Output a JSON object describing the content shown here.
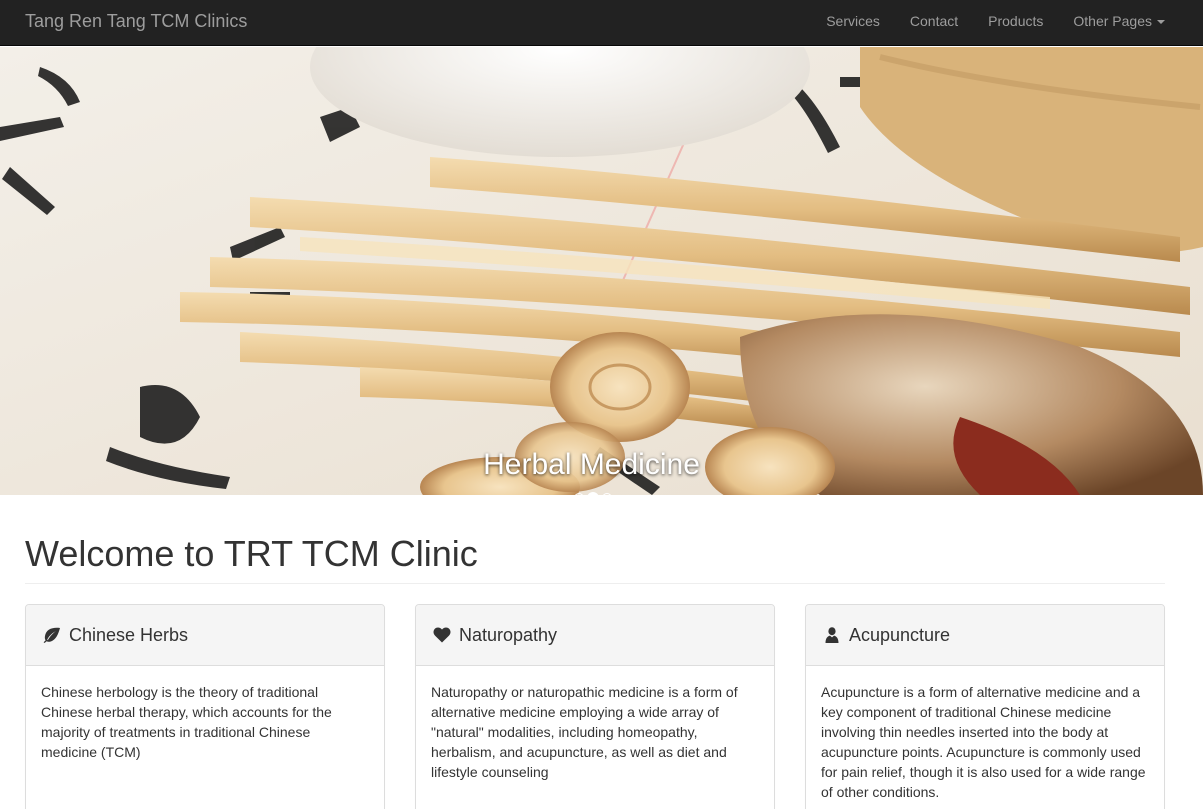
{
  "navbar": {
    "brand": "Tang Ren Tang TCM Clinics",
    "items": [
      {
        "label": "Services"
      },
      {
        "label": "Contact"
      },
      {
        "label": "Products"
      },
      {
        "label": "Other Pages",
        "dropdown": true
      }
    ]
  },
  "carousel": {
    "caption": "Herbal Medicine",
    "slide_count": 3,
    "active_index": 1
  },
  "welcome": {
    "title": "Welcome to TRT TCM Clinic"
  },
  "panels": [
    {
      "icon": "leaf-icon",
      "title": "Chinese Herbs",
      "body": "Chinese herbology is the theory of traditional Chinese herbal therapy, which accounts for the majority of treatments in traditional Chinese medicine (TCM)"
    },
    {
      "icon": "heart-icon",
      "title": "Naturopathy",
      "body": "Naturopathy or naturopathic medicine is a form of alternative medicine employing a wide array of \"natural\" modalities, including homeopathy, herbalism, and acupuncture, as well as diet and lifestyle counseling"
    },
    {
      "icon": "user-icon",
      "title": "Acupuncture",
      "body": "Acupuncture is a form of alternative medicine and a key component of traditional Chinese medicine involving thin needles inserted into the body at acupuncture points. Acupuncture is commonly used for pain relief, though it is also used for a wide range of other conditions."
    }
  ],
  "colors": {
    "navbar_bg": "#222222",
    "navbar_text": "#9d9d9d",
    "panel_heading_bg": "#f5f5f5",
    "panel_border": "#dddddd"
  }
}
